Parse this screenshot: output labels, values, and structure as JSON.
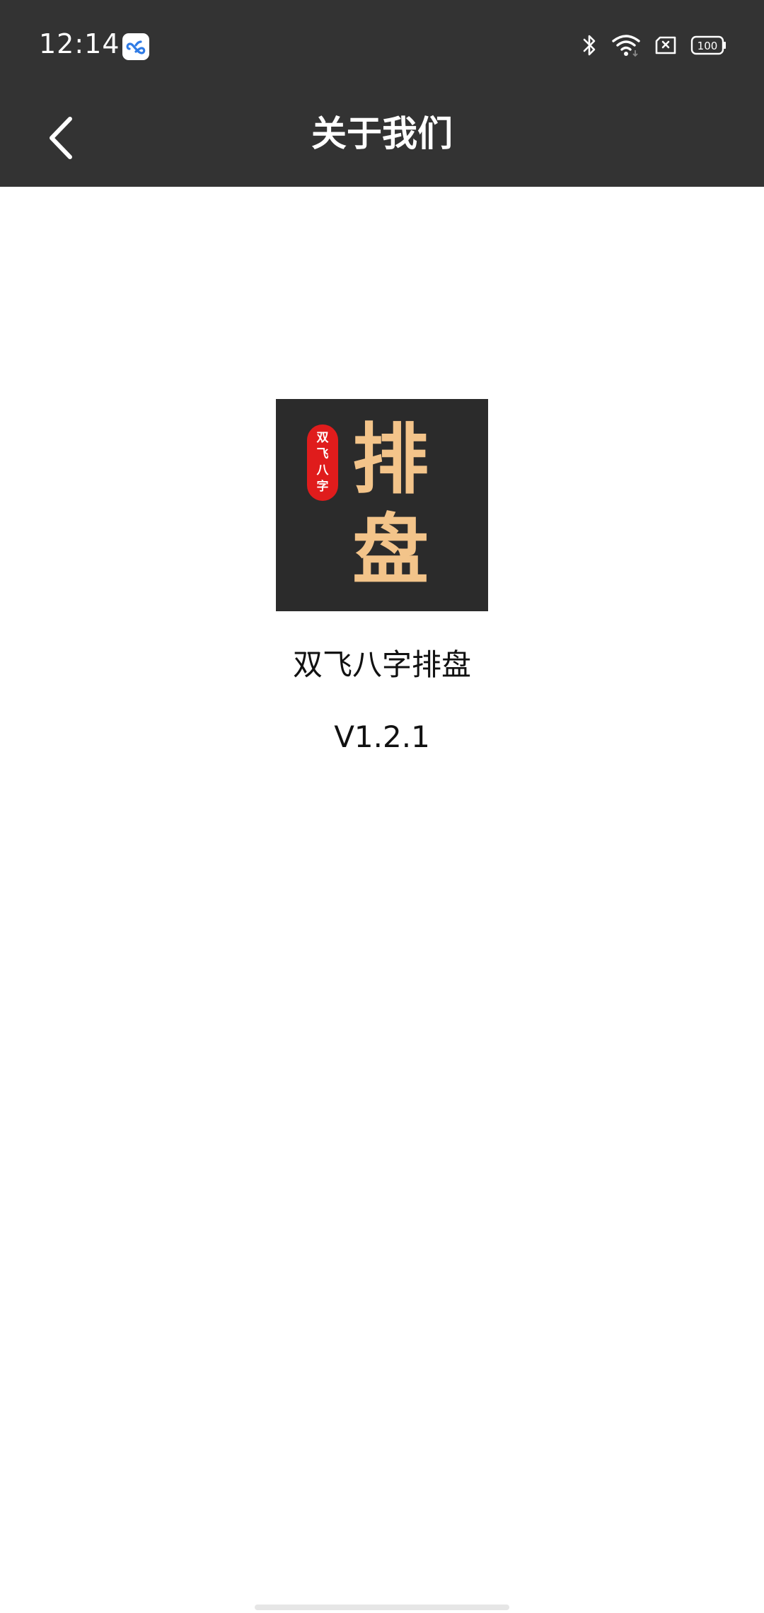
{
  "status_bar": {
    "time": "12:14",
    "battery_level": "100",
    "icons": [
      "app-notification-icon",
      "bluetooth-icon",
      "wifi-icon",
      "no-sim-icon",
      "battery-icon"
    ]
  },
  "app_bar": {
    "title": "关于我们",
    "back_icon": "back-arrow-icon"
  },
  "logo": {
    "seal_chars": [
      "双",
      "飞",
      "八",
      "字"
    ],
    "main_chars": [
      "排",
      "盘"
    ],
    "colors": {
      "background": "#2b2b2b",
      "seal": "#e01c1c",
      "characters": "#f3c48a"
    }
  },
  "app_info": {
    "name": "双飞八字排盘",
    "version": "V1.2.1"
  },
  "colors": {
    "top_bar": "#333333",
    "page_background": "#ffffff",
    "text": "#111111"
  }
}
